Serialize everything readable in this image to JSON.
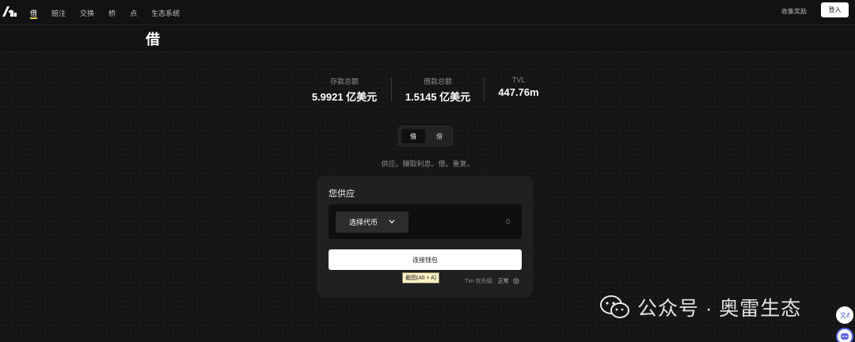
{
  "nav": {
    "items": [
      "借",
      "赔注",
      "交换",
      "桥",
      "点",
      "生态系统"
    ],
    "active_index": 0,
    "claim_rewards": "收集奖励",
    "login": "登入"
  },
  "page": {
    "title": "借"
  },
  "stats": {
    "deposits_label": "存款总额",
    "deposits_value": "5.9921 亿美元",
    "borrows_label": "借款总额",
    "borrows_value": "1.5145 亿美元",
    "tvl_label": "TVL",
    "tvl_value": "447.76m"
  },
  "toggle": {
    "left": "借",
    "right": "借"
  },
  "tagline": "供应。赚取利息。借。重复。",
  "card": {
    "title": "您供应",
    "token_select": "选择代币",
    "amount": "0",
    "connect_button": "连接钱包",
    "tooltip": "截图(Alt + A)",
    "tx_label": "Txn 优先级:",
    "tx_value": "正常"
  },
  "watermark": {
    "text": "公众号 · 奥雷生态"
  },
  "colors": {
    "background": "#141516",
    "card": "#1e2022",
    "accent": "#e3d24a"
  },
  "icons": [
    "logo-icon",
    "chevron-down-icon",
    "gear-icon",
    "wechat-icon",
    "translate-icon",
    "assistant-icon"
  ]
}
